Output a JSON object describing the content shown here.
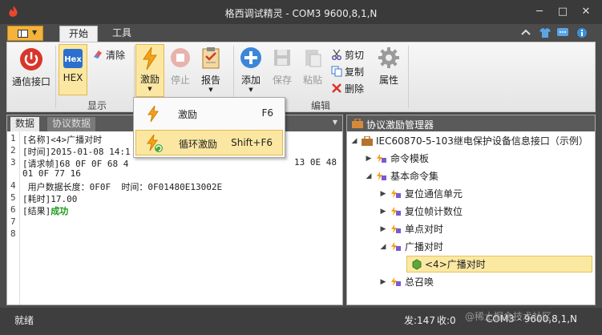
{
  "window": {
    "title": "格西调试精灵 - COM3  9600,8,1,N",
    "minimize": "─",
    "maximize": "□",
    "close": "✕"
  },
  "ribbon_tabs": [
    "开始",
    "工具"
  ],
  "ribbon": {
    "comm_label": "通信接口",
    "hex_label": "HEX",
    "clear_label": "清除",
    "display_group": "显示",
    "stim_label": "激励",
    "stop_label": "停止",
    "report_label": "报告",
    "add_label": "添加",
    "save_label": "保存",
    "paste_label": "粘贴",
    "cut_label": "剪切",
    "copy_label": "复制",
    "delete_label": "删除",
    "props_label": "属性",
    "edit_group": "编辑"
  },
  "stim_menu": [
    {
      "label": "激励",
      "shortcut": "F6"
    },
    {
      "label": "循环激励",
      "shortcut": "Shift+F6"
    }
  ],
  "left_tabs": [
    "数据",
    "协议数据"
  ],
  "data_lines": [
    {
      "n": "1",
      "text": "[名称]<4>广播对时"
    },
    {
      "n": "2",
      "text": "[时间]2015-01-08 14:1"
    },
    {
      "n": "3",
      "text": "[请求帧]68 0F 0F 68 4"
    },
    {
      "n": "",
      "text": "01 0F 77 16"
    },
    {
      "n": "4",
      "text": " 用户数据长度：0F0F  时间：0F01480E13002E"
    },
    {
      "n": "5",
      "text": "[耗时]17.00"
    },
    {
      "n": "6",
      "text": "[结果]",
      "ok": "成功"
    },
    {
      "n": "7",
      "text": ""
    },
    {
      "n": "8",
      "text": ""
    }
  ],
  "line3_tail": "13 0E 48",
  "right_panel": {
    "title": "协议激励管理器",
    "tree": [
      {
        "label": "IEC60870-5-103继电保护设备信息接口（示例）",
        "expanded": true,
        "depth": 0
      },
      {
        "label": "命令模板",
        "expanded": false,
        "depth": 1
      },
      {
        "label": "基本命令集",
        "expanded": true,
        "depth": 1
      },
      {
        "label": "复位通信单元",
        "expanded": false,
        "depth": 2
      },
      {
        "label": "复位帧计数位",
        "expanded": false,
        "depth": 2
      },
      {
        "label": "单点对时",
        "expanded": false,
        "depth": 2
      },
      {
        "label": "广播对时",
        "expanded": true,
        "depth": 2
      },
      {
        "label": "<4>广播对时",
        "expanded": null,
        "depth": 3,
        "selected": true
      },
      {
        "label": "总召唤",
        "expanded": false,
        "depth": 2
      }
    ]
  },
  "status": {
    "ready": "就绪",
    "s2": "发:147",
    "s3": "收:0",
    "s4": "COM3 - 9600,8,1,N",
    "watermark": "@稀土掘金技术社区"
  },
  "colors": {
    "accent": "#f3b33c",
    "selected": "#fbe9a3",
    "ok": "#1b9a1b"
  }
}
